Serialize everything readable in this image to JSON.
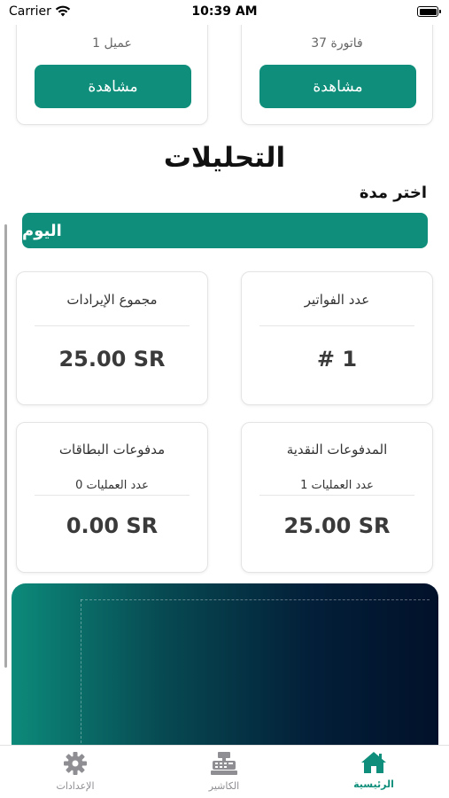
{
  "status_bar": {
    "carrier": "Carrier",
    "time": "10:39 AM"
  },
  "top_cards": {
    "invoices": {
      "count": "37 فاتورة",
      "button": "مشاهدة"
    },
    "customers": {
      "count": "1 عميل",
      "button": "مشاهدة"
    }
  },
  "analytics": {
    "title": "التحليلات",
    "period_label": "اختر مدة",
    "period_value": "اليوم"
  },
  "stats": {
    "invoice_count": {
      "title": "عدد الفواتير",
      "value": "# 1"
    },
    "revenue_total": {
      "title": "مجموع الإيرادات",
      "value": "25.00 SR"
    },
    "cash_payments": {
      "title": "المدفوعات النقدية",
      "ops": "عدد العمليات 1",
      "value": "25.00 SR"
    },
    "card_payments": {
      "title": "مدفوعات البطاقات",
      "ops": "عدد العمليات 0",
      "value": "0.00 SR"
    }
  },
  "tabs": [
    {
      "label": "الرئيسية",
      "icon": "home-icon",
      "active": true
    },
    {
      "label": "الكاشير",
      "icon": "cash-register-icon",
      "active": false
    },
    {
      "label": "الإعدادات",
      "icon": "gear-icon",
      "active": false
    }
  ],
  "colors": {
    "accent": "#0f8f7b",
    "gradient_dark": "#02112a",
    "inactive_tab": "#8e8e93"
  }
}
